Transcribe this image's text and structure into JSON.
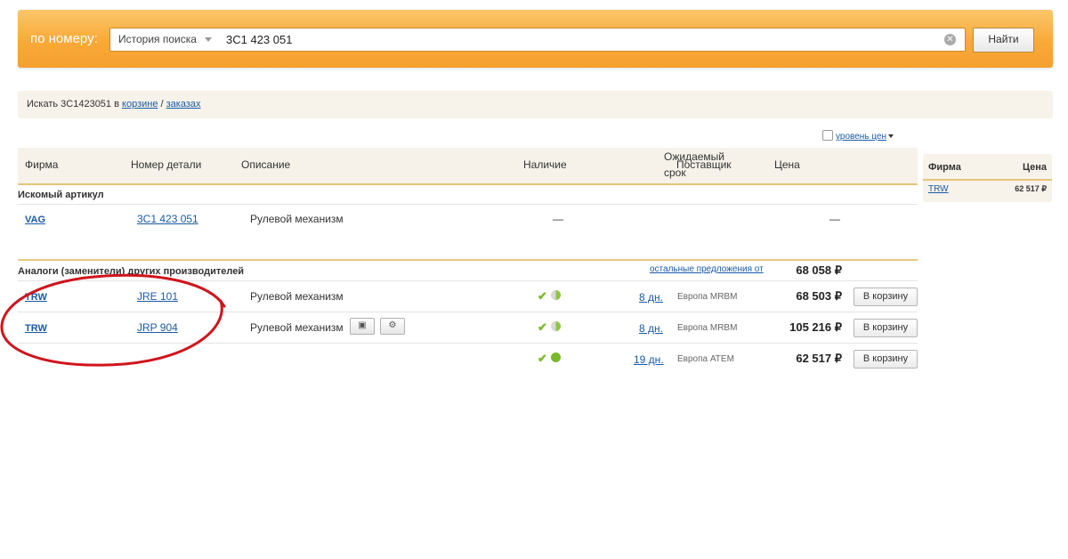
{
  "search": {
    "label": "по номеру:",
    "history_label": "История поиска",
    "value": "3C1 423 051",
    "clear_glyph": "✕",
    "submit_label": "Найти"
  },
  "info": {
    "prefix": "Искать 3C1423051 в ",
    "cart_link": "корзине",
    "separator": " / ",
    "orders_link": "заказах"
  },
  "price_level": {
    "label": "уровень цен"
  },
  "table": {
    "headers": {
      "brand": "Фирма",
      "part_number": "Номер детали",
      "description": "Описание",
      "availability": "Наличие",
      "expected_line1": "Ожидаемый",
      "expected_line2": "срок",
      "supplier": "Поставщик",
      "price": "Цена"
    },
    "sought": {
      "title": "Искомый артикул",
      "row": {
        "brand": "VAG",
        "number": "3C1 423 051",
        "description": "Рулевой механизм",
        "availability": "—",
        "price": "—"
      }
    },
    "analogs": {
      "title": "Аналоги (заменители) других производителей",
      "other_offers_label": "остальные предложения от",
      "other_offers_price": "68 058 ₽",
      "rows": [
        {
          "brand": "TRW",
          "number": "JRE 101",
          "description": "Рулевой механизм",
          "availability": "✔",
          "term": "8 дн.",
          "supplier": "Европа MRBM",
          "price": "68 503 ₽",
          "cart": "В корзину"
        },
        {
          "brand": "TRW",
          "number": "JRP 904",
          "description": "Рулевой механизм",
          "availability": "✔",
          "term": "8 дн.",
          "supplier": "Европа MRBM",
          "price": "105 216 ₽",
          "cart": "В корзину"
        },
        {
          "brand": "",
          "number": "",
          "description": "",
          "availability": "✔",
          "term": "19 дн.",
          "supplier": "Европа ATEM",
          "price": "62 517 ₽",
          "cart": "В корзину"
        }
      ]
    }
  },
  "side": {
    "header_brand": "Фирма",
    "header_price": "Цена",
    "row": {
      "brand": "TRW",
      "price": "62 517 ₽"
    }
  },
  "colors": {
    "accent": "#f9a938",
    "link": "#1a5aa6",
    "annotation": "#d0141b",
    "check": "#7ab928"
  }
}
